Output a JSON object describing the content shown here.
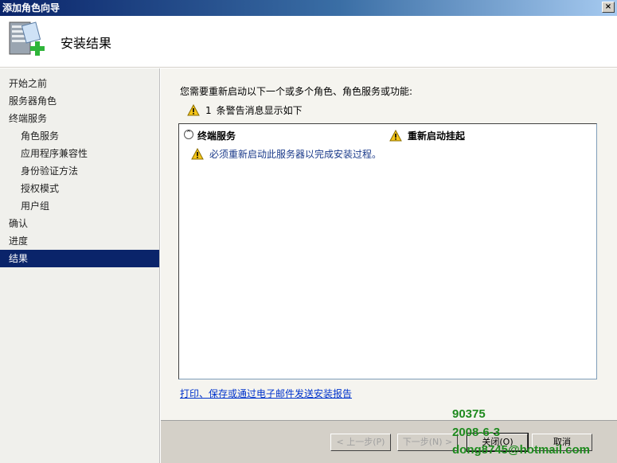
{
  "window": {
    "title": "添加角色向导",
    "close_label": "×"
  },
  "header": {
    "title": "安装结果",
    "icon": "server-add-icon"
  },
  "sidebar": {
    "items": [
      {
        "label": "开始之前",
        "level": 0,
        "active": false
      },
      {
        "label": "服务器角色",
        "level": 0,
        "active": false
      },
      {
        "label": "终端服务",
        "level": 0,
        "active": false
      },
      {
        "label": "角色服务",
        "level": 1,
        "active": false
      },
      {
        "label": "应用程序兼容性",
        "level": 1,
        "active": false
      },
      {
        "label": "身份验证方法",
        "level": 1,
        "active": false
      },
      {
        "label": "授权模式",
        "level": 1,
        "active": false
      },
      {
        "label": "用户组",
        "level": 1,
        "active": false
      },
      {
        "label": "确认",
        "level": 0,
        "active": false
      },
      {
        "label": "进度",
        "level": 0,
        "active": false
      },
      {
        "label": "结果",
        "level": 0,
        "active": true
      }
    ]
  },
  "main": {
    "intro": "您需要重新启动以下一个或多个角色、角色服务或功能:",
    "warning_count": "1",
    "warning_text": "条警告消息显示如下",
    "list": {
      "role_name": "终端服务",
      "status": "重新启动挂起",
      "message": "必须重新启动此服务器以完成安装过程。"
    },
    "report_link": "打印、保存或通过电子邮件发送安装报告"
  },
  "footer": {
    "prev_label": "< 上一步(P)",
    "next_label": "下一步(N) >",
    "close_label": "关闭(O)",
    "cancel_label": "取消"
  },
  "watermark": {
    "line1": "90375",
    "line2": "2008-6-3",
    "line3": "dong8745@hotmail.com"
  },
  "colors": {
    "accent": "#0a246a",
    "warning": "#f5c518",
    "link": "#0033cc",
    "watermark": "#1e8a1e"
  }
}
